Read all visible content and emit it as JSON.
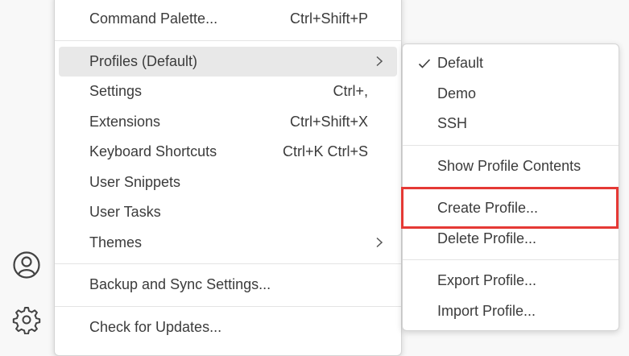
{
  "activity_bar": {
    "icons": [
      "account-icon",
      "manage-gear-icon"
    ]
  },
  "main_menu": {
    "command_palette": {
      "label": "Command Palette...",
      "shortcut": "Ctrl+Shift+P"
    },
    "profiles": {
      "label": "Profiles (Default)"
    },
    "settings": {
      "label": "Settings",
      "shortcut": "Ctrl+,"
    },
    "extensions": {
      "label": "Extensions",
      "shortcut": "Ctrl+Shift+X"
    },
    "keyboard_shortcuts": {
      "label": "Keyboard Shortcuts",
      "shortcut": "Ctrl+K Ctrl+S"
    },
    "user_snippets": {
      "label": "User Snippets"
    },
    "user_tasks": {
      "label": "User Tasks"
    },
    "themes": {
      "label": "Themes"
    },
    "backup_sync": {
      "label": "Backup and Sync Settings..."
    },
    "check_updates": {
      "label": "Check for Updates..."
    }
  },
  "profiles_submenu": {
    "profiles": [
      {
        "label": "Default",
        "checked": true
      },
      {
        "label": "Demo",
        "checked": false
      },
      {
        "label": "SSH",
        "checked": false
      }
    ],
    "show_contents": {
      "label": "Show Profile Contents"
    },
    "create": {
      "label": "Create Profile..."
    },
    "delete": {
      "label": "Delete Profile..."
    },
    "export": {
      "label": "Export Profile..."
    },
    "import": {
      "label": "Import Profile..."
    }
  },
  "colors": {
    "highlight_box": "#e53935",
    "active_item_bg": "#e8e8e8"
  }
}
